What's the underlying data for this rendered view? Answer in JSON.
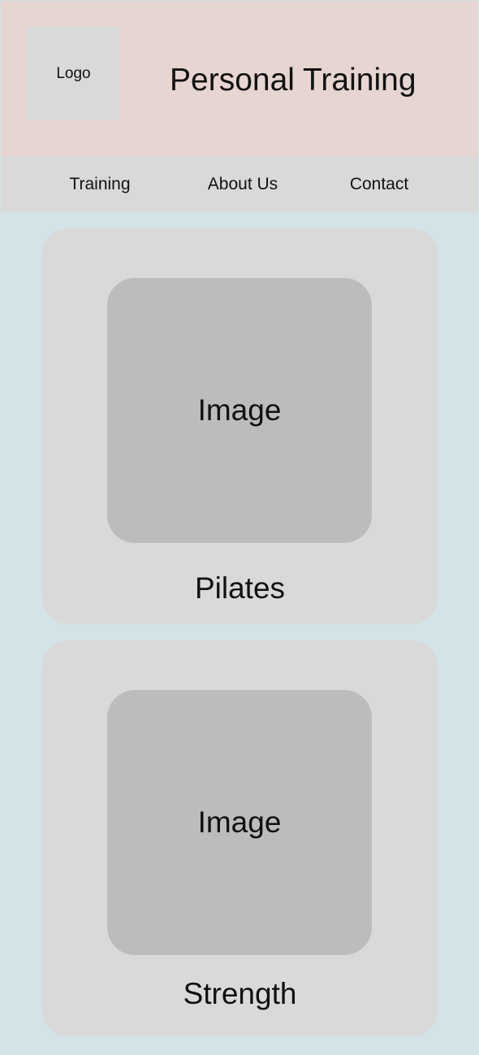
{
  "header": {
    "logo_label": "Logo",
    "title": "Personal Training"
  },
  "nav": {
    "items": [
      {
        "label": "Training"
      },
      {
        "label": "About Us"
      },
      {
        "label": "Contact"
      }
    ]
  },
  "cards": [
    {
      "image_label": "Image",
      "title": "Pilates"
    },
    {
      "image_label": "Image",
      "title": "Strength"
    }
  ],
  "colors": {
    "page_background": "#d3e3e8",
    "header_background": "#e6d5d1",
    "nav_background": "#d9d9d9",
    "card_background": "#d9d9d9",
    "image_placeholder": "#bdbcbd"
  }
}
